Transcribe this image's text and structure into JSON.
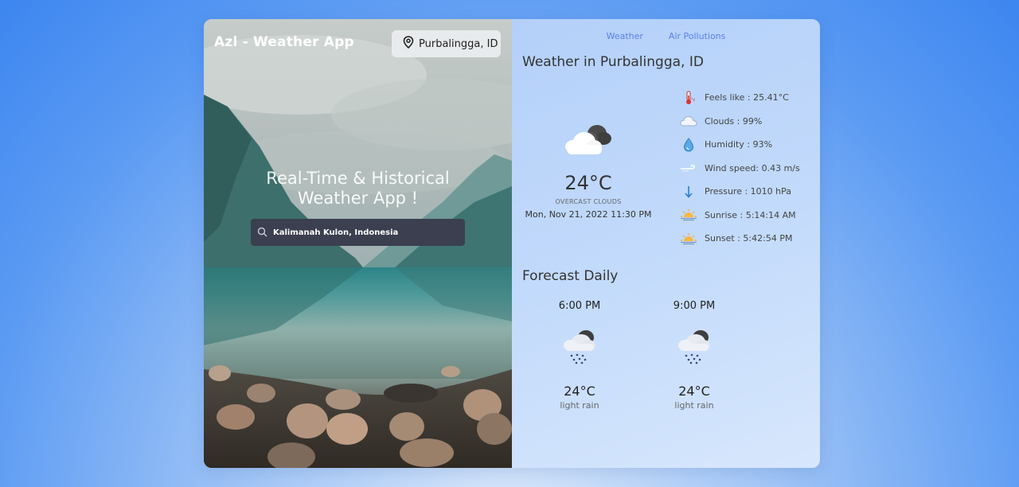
{
  "app": {
    "brand": "Azl - Weather App",
    "location_pill": "Purbalingga, ID"
  },
  "hero": {
    "line1": "Real-Time & Historical",
    "line2": "Weather App !"
  },
  "search": {
    "value": "Kalimanah Kulon, Indonesia",
    "icon": "search-icon"
  },
  "tabs": [
    {
      "label": "Weather"
    },
    {
      "label": "Air Pollutions"
    }
  ],
  "current": {
    "title": "Weather in Purbalingga, ID",
    "temp": "24°C",
    "description": "OVERCAST CLOUDS",
    "datetime": "Mon, Nov 21, 2022 11:30 PM",
    "icon": "overcast-clouds-icon"
  },
  "stats": [
    {
      "label": "Feels like : 25.41°C",
      "icon": "thermometer-icon"
    },
    {
      "label": "Clouds : 99%",
      "icon": "cloud-icon"
    },
    {
      "label": "Humidity : 93%",
      "icon": "droplet-icon"
    },
    {
      "label": "Wind speed: 0.43 m/s",
      "icon": "wind-icon"
    },
    {
      "label": "Pressure : 1010 hPa",
      "icon": "arrow-down-icon"
    },
    {
      "label": "Sunrise : 5:14:14 AM",
      "icon": "sunrise-icon"
    },
    {
      "label": "Sunset : 5:42:54 PM",
      "icon": "sunset-icon"
    }
  ],
  "forecast": {
    "title": "Forecast Daily",
    "items": [
      {
        "time": "6:00 PM",
        "temp": "24°C",
        "desc": "light rain",
        "icon": "rain-cloud-icon"
      },
      {
        "time": "9:00 PM",
        "temp": "24°C",
        "desc": "light rain",
        "icon": "rain-cloud-icon"
      }
    ]
  },
  "colors": {
    "tab_link": "#5b7fe6",
    "search_bg": "#3b3f4f",
    "pill_bg": "#eceef0"
  }
}
